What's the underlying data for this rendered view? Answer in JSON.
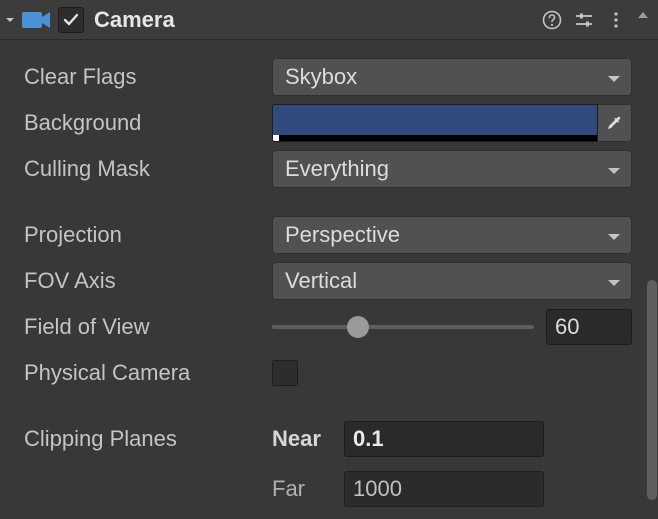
{
  "header": {
    "title": "Camera",
    "enabled": true
  },
  "props": {
    "clear_flags": {
      "label": "Clear Flags",
      "value": "Skybox"
    },
    "background": {
      "label": "Background",
      "color": "#324A7E"
    },
    "culling_mask": {
      "label": "Culling Mask",
      "value": "Everything"
    },
    "projection": {
      "label": "Projection",
      "value": "Perspective"
    },
    "fov_axis": {
      "label": "FOV Axis",
      "value": "Vertical"
    },
    "field_of_view": {
      "label": "Field of View",
      "value": "60",
      "percent": 33
    },
    "physical_camera": {
      "label": "Physical Camera",
      "checked": false
    },
    "clipping_planes": {
      "label": "Clipping Planes",
      "near_label": "Near",
      "near_value": "0.1",
      "far_label": "Far",
      "far_value": "1000"
    }
  }
}
